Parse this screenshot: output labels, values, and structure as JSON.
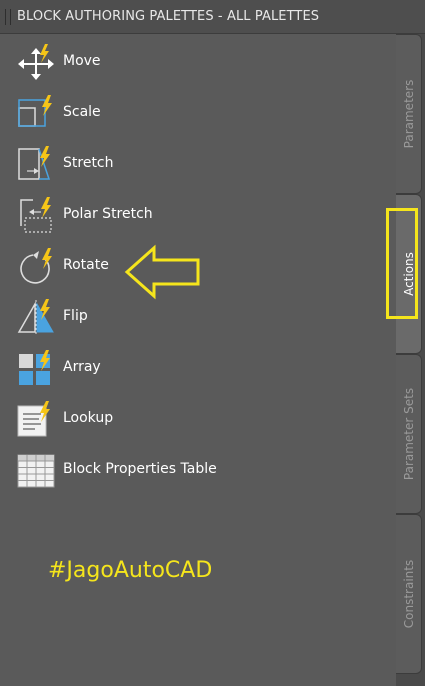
{
  "palette": {
    "title": "BLOCK AUTHORING PALETTES - ALL PALETTES"
  },
  "actions": [
    {
      "label": "Move",
      "icon": "move-icon"
    },
    {
      "label": "Scale",
      "icon": "scale-icon"
    },
    {
      "label": "Stretch",
      "icon": "stretch-icon"
    },
    {
      "label": "Polar Stretch",
      "icon": "polar-stretch-icon"
    },
    {
      "label": "Rotate",
      "icon": "rotate-icon"
    },
    {
      "label": "Flip",
      "icon": "flip-icon"
    },
    {
      "label": "Array",
      "icon": "array-icon"
    },
    {
      "label": "Lookup",
      "icon": "lookup-icon"
    },
    {
      "label": "Block Properties Table",
      "icon": "block-properties-table-icon"
    }
  ],
  "tabs": [
    {
      "label": "Parameters"
    },
    {
      "label": "Actions",
      "active": true
    },
    {
      "label": "Parameter Sets"
    },
    {
      "label": "Constraints"
    }
  ],
  "annotation": {
    "hashtag": "#JagoAutoCAD"
  },
  "colors": {
    "background": "#5a5a5a",
    "highlight": "#f5e51c",
    "bolt": "#f5c518"
  }
}
